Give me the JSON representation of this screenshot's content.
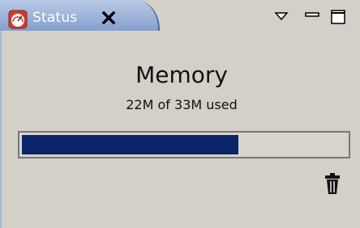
{
  "tab": {
    "label": "Status",
    "icon": "gauge-icon",
    "close_icon": "close-icon"
  },
  "window_controls": {
    "menu_icon": "view-menu-icon",
    "minimize_icon": "minimize-icon",
    "maximize_icon": "maximize-icon"
  },
  "memory": {
    "title": "Memory",
    "usage_text": "22M of 33M used",
    "used_mb": 22,
    "total_mb": 33
  },
  "actions": {
    "gc_icon": "trash-icon"
  },
  "colors": {
    "tab_gradient_top": "#b9cbe6",
    "tab_gradient_bottom": "#7c98c8",
    "panel_bg": "#d4d0c8",
    "progress_fill": "#0a246a"
  }
}
